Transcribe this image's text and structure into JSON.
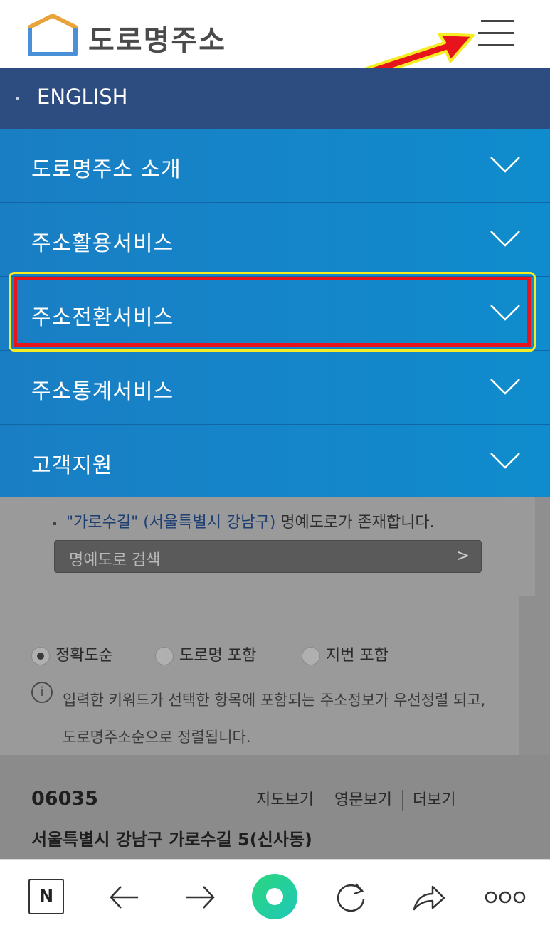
{
  "header": {
    "logo_text": "도로명주소",
    "menu_icon": "hamburger-menu-icon"
  },
  "english_bar": {
    "label": "ENGLISH"
  },
  "menu": {
    "items": [
      {
        "label": "도로명주소 소개"
      },
      {
        "label": "주소활용서비스"
      },
      {
        "label": "주소전환서비스"
      },
      {
        "label": "주소통계서비스"
      },
      {
        "label": "고객지원"
      }
    ]
  },
  "background": {
    "notice_quote": "\"가로수길\" (서울특별시 강남구)",
    "notice_rest": " 명예도로가 존재합니다.",
    "search_placeholder": "명예도로 검색",
    "radios": [
      {
        "label": "정확도순",
        "selected": true
      },
      {
        "label": "도로명 포함",
        "selected": false
      },
      {
        "label": "지번 포함",
        "selected": false
      }
    ],
    "info_text": "입력한 키워드가 선택한 항목에 포함되는 주소정보가 우선정렬 되고, 도로명주소순으로 정렬됩니다.",
    "zipcode": "06035",
    "links": [
      "지도보기",
      "영문보기",
      "더보기"
    ],
    "address": "서울특별시 강남구 가로수길 5(신사동)"
  },
  "bottom_nav": {
    "n_label": "N"
  },
  "colors": {
    "english_bar": "#2d4c7f",
    "menu_bg": "#1a7ec4",
    "highlight_outer": "#f5ec21",
    "highlight_inner": "#e8141b",
    "home_button": "#2ad67e"
  }
}
